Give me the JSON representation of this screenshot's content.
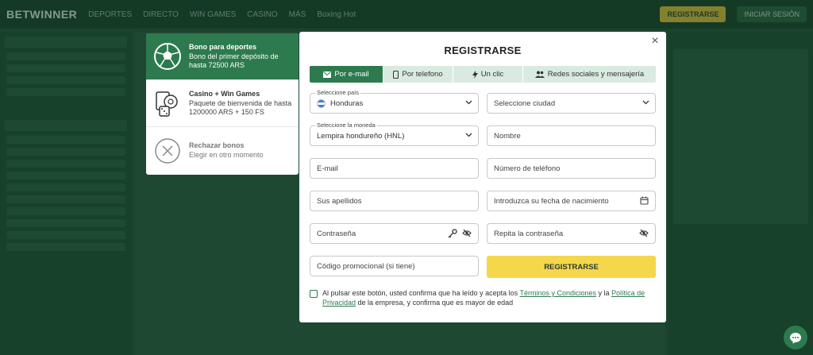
{
  "site": {
    "logo_text": "BETWINNER",
    "nav": [
      "DEPORTES",
      "DIRECTO",
      "WIN GAMES",
      "CASINO",
      "MÁS",
      "Boxing Hot"
    ],
    "register_button": "REGISTRARSE",
    "login_button": "INICIAR SESIÓN"
  },
  "bonus": {
    "items": [
      {
        "title": "Bono para deportes",
        "desc": "Bono del primer depósito de hasta 72500 ARS",
        "icon": "soccer-ball-icon"
      },
      {
        "title": "Casino + Win Games",
        "desc": "Paquete de bienvenida de hasta 1200000 ARS + 150 FS",
        "icon": "casino-chips-icon"
      },
      {
        "title": "Rechazar bonos",
        "desc": "Elegir en otro momento",
        "icon": "close-circle-icon"
      }
    ]
  },
  "modal": {
    "title": "REGISTRARSE",
    "close_glyph": "×",
    "tabs": [
      {
        "label": "Por e-mail",
        "icon": "envelope-icon"
      },
      {
        "label": "Por telefono",
        "icon": "phone-icon"
      },
      {
        "label": "Un clic",
        "icon": "lightning-icon"
      },
      {
        "label": "Redes sociales y mensajería",
        "icon": "people-icon"
      }
    ],
    "country": {
      "label": "Seleccione país",
      "value": "Honduras"
    },
    "city": {
      "placeholder": "Seleccione ciudad"
    },
    "currency": {
      "label": "Seleccione la moneda",
      "value": "Lempira hondureño (HNL)"
    },
    "name": {
      "placeholder": "Nombre"
    },
    "email": {
      "placeholder": "E-mail"
    },
    "phone": {
      "placeholder": "Número de teléfono"
    },
    "surname": {
      "placeholder": "Sus apellidos"
    },
    "birthdate": {
      "placeholder": "Introduzca su fecha de nacimiento"
    },
    "password": {
      "placeholder": "Contraseña"
    },
    "repeat_password": {
      "placeholder": "Repita la contraseña"
    },
    "promo": {
      "placeholder": "Código promocional (si tiene)"
    },
    "submit": "REGISTRARSE",
    "consent": {
      "before": "Al pulsar este botón, usted confirma que ha leído y acepta los ",
      "terms_link": "Términos y Condiciones",
      "middle": " y la ",
      "privacy_link": "Política de Privacidad",
      "after": " de la empresa, y confirma que es mayor de edad"
    }
  },
  "colors": {
    "accent_green": "#2d7a4e",
    "submit_yellow": "#f5d74b"
  }
}
